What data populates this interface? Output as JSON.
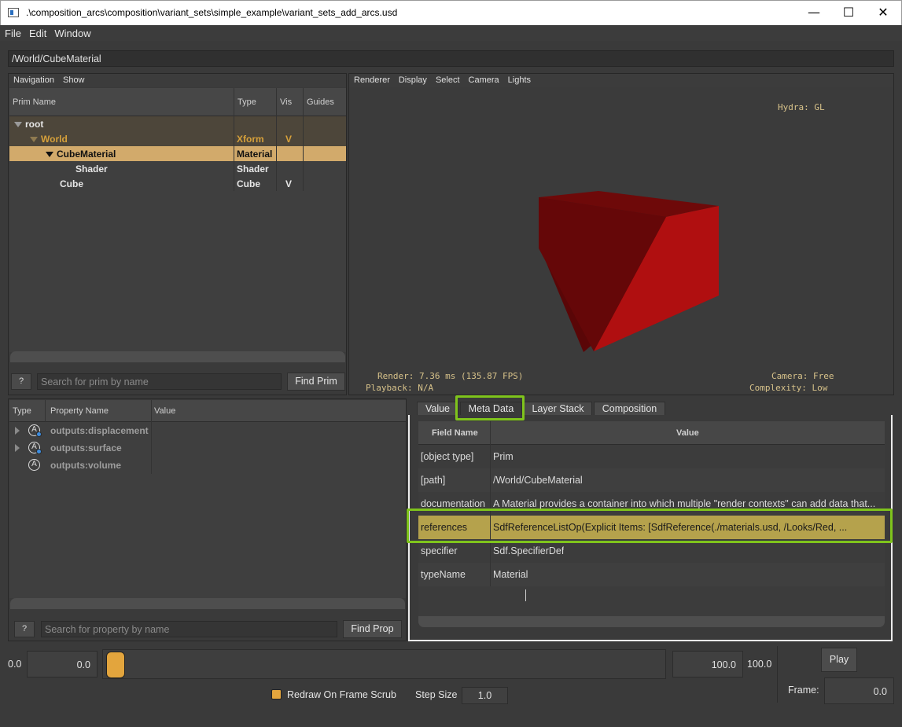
{
  "window": {
    "title": ".\\composition_arcs\\composition\\variant_sets\\simple_example\\variant_sets_add_arcs.usd",
    "minimize": "—",
    "maximize": "☐",
    "close": "✕"
  },
  "menubar": [
    "File",
    "Edit",
    "Window"
  ],
  "path": "/World/CubeMaterial",
  "prim_panel": {
    "menu": [
      "Navigation",
      "Show"
    ],
    "columns": [
      "Prim Name",
      "Type",
      "Vis",
      "Guides"
    ],
    "rows": [
      {
        "name": "root",
        "type": "",
        "vis": ""
      },
      {
        "name": "World",
        "type": "Xform",
        "vis": "V"
      },
      {
        "name": "CubeMaterial",
        "type": "Material",
        "vis": ""
      },
      {
        "name": "Shader",
        "type": "Shader",
        "vis": ""
      },
      {
        "name": "Cube",
        "type": "Cube",
        "vis": "V"
      }
    ],
    "help": "?",
    "search_placeholder": "Search for prim by name",
    "find_button": "Find Prim"
  },
  "viewport": {
    "menu": [
      "Renderer",
      "Display",
      "Select",
      "Camera",
      "Lights"
    ],
    "hud_renderer": "Hydra: GL",
    "hud_render": "Render: 7.36 ms (135.87 FPS)",
    "hud_playback": "Playback: N/A",
    "hud_camera": "Camera: Free",
    "hud_complexity": "Complexity: Low",
    "cube_color": "#b00f10"
  },
  "property_panel": {
    "columns": [
      "Type",
      "Property Name",
      "Value"
    ],
    "rows": [
      {
        "name": "outputs:displacement"
      },
      {
        "name": "outputs:surface"
      },
      {
        "name": "outputs:volume"
      }
    ],
    "help": "?",
    "search_placeholder": "Search for property by name",
    "find_button": "Find Prop"
  },
  "meta_panel": {
    "tabs": [
      "Value",
      "Meta Data",
      "Layer Stack",
      "Composition"
    ],
    "active_tab": "Meta Data",
    "columns": [
      "Field Name",
      "Value"
    ],
    "rows": [
      {
        "field": "[object type]",
        "value": "Prim"
      },
      {
        "field": "[path]",
        "value": "/World/CubeMaterial"
      },
      {
        "field": "documentation",
        "value": "A Material provides a container into which multiple \"render contexts\" can add data that..."
      },
      {
        "field": "references",
        "value": "SdfReferenceListOp(Explicit Items: [SdfReference(./materials.usd, /Looks/Red, ..."
      },
      {
        "field": "specifier",
        "value": "Sdf.SpecifierDef"
      },
      {
        "field": "typeName",
        "value": "Material"
      }
    ],
    "highlight_color": "#7fc41c"
  },
  "timeline": {
    "start_label": "0.0",
    "start_value": "0.0",
    "end_value": "100.0",
    "end_label": "100.0",
    "play_button": "Play",
    "redraw_label": "Redraw On Frame Scrub",
    "redraw_checked": true,
    "step_label": "Step Size",
    "step_value": "1.0",
    "frame_label": "Frame:",
    "frame_value": "0.0"
  }
}
